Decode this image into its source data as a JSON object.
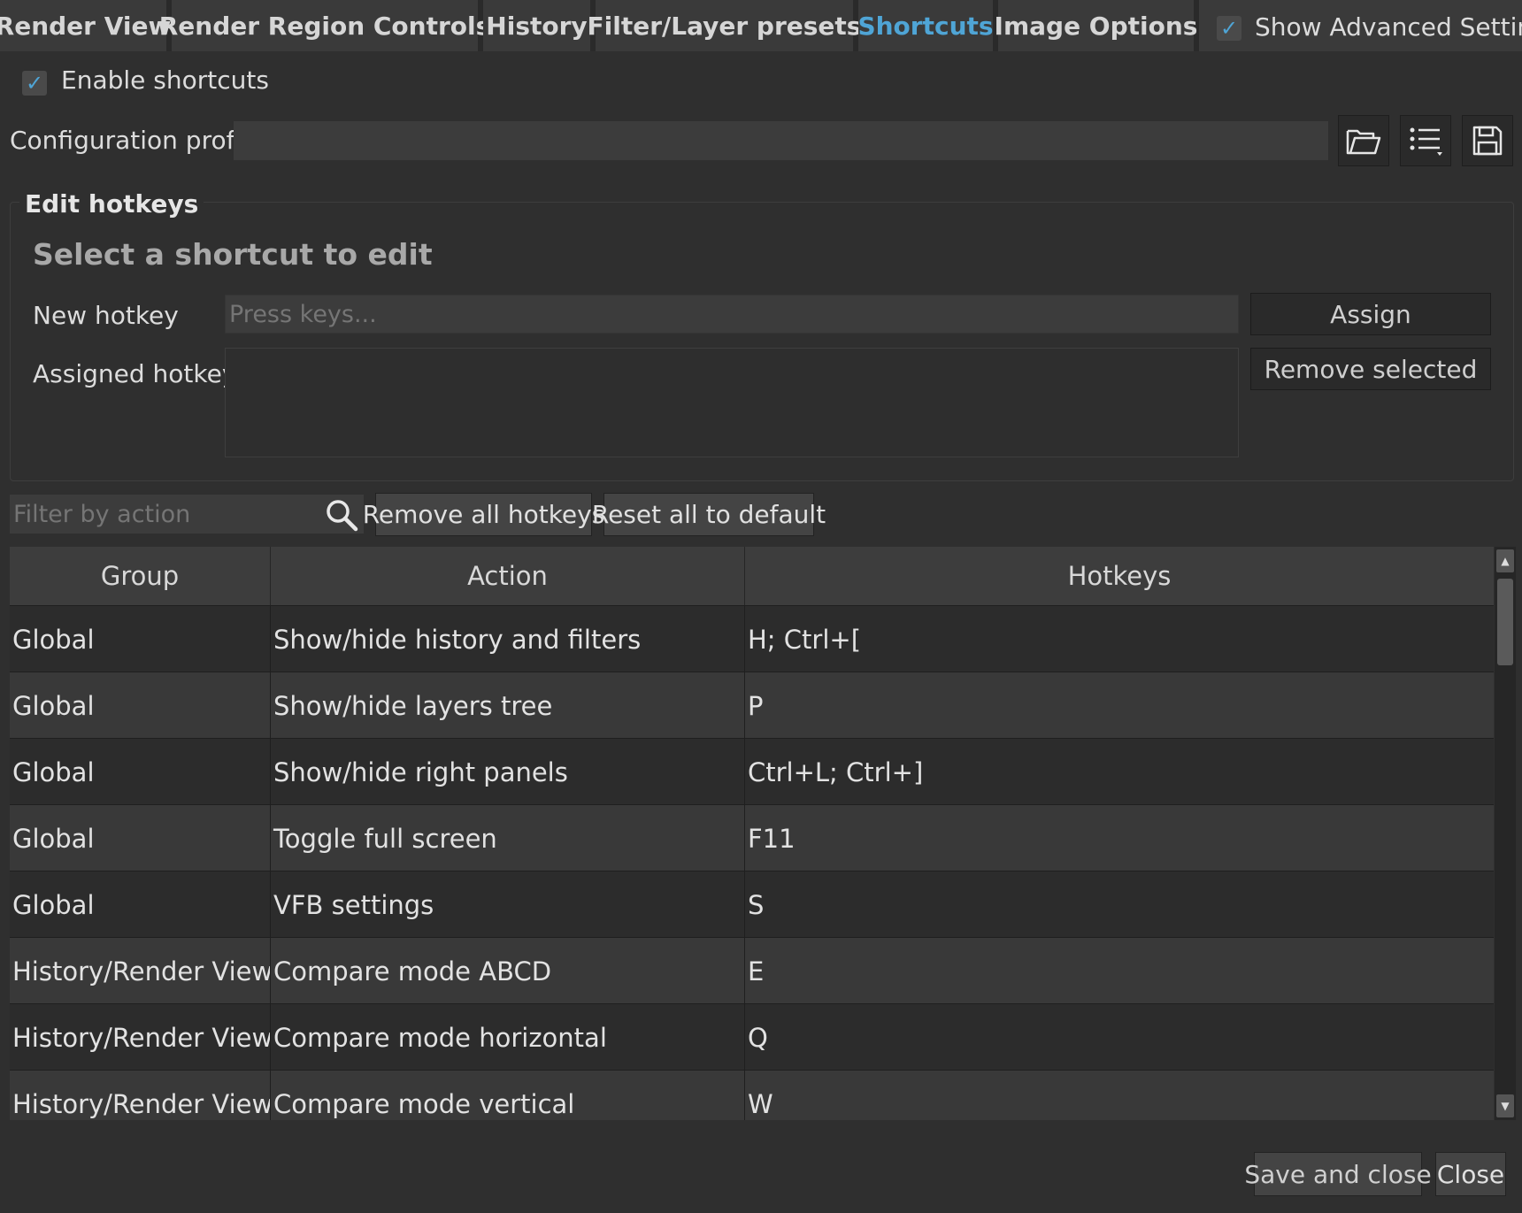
{
  "tabs": [
    {
      "label": "Render View"
    },
    {
      "label": "Render Region Controls"
    },
    {
      "label": "History"
    },
    {
      "label": "Filter/Layer presets"
    },
    {
      "label": "Shortcuts"
    },
    {
      "label": "Image Options"
    }
  ],
  "active_tab": "Shortcuts",
  "advanced": {
    "label": "Show Advanced Settings",
    "checked": true
  },
  "enable_shortcuts": {
    "label": "Enable shortcuts",
    "checked": true
  },
  "config": {
    "label": "Configuration profile",
    "value": ""
  },
  "edit": {
    "title": "Edit hotkeys",
    "heading": "Select a shortcut to edit",
    "new_hotkey_label": "New hotkey",
    "new_hotkey_placeholder": "Press keys...",
    "assigned_label": "Assigned hotkeys",
    "assign_button": "Assign",
    "remove_selected_button": "Remove selected"
  },
  "filter": {
    "placeholder": "Filter by action"
  },
  "remove_all_button": "Remove all hotkeys",
  "reset_all_button": "Reset all to default",
  "table": {
    "columns": [
      "Group",
      "Action",
      "Hotkeys"
    ],
    "rows": [
      {
        "group": "Global",
        "action": "Show/hide history and filters",
        "hotkeys": "H; Ctrl+["
      },
      {
        "group": "Global",
        "action": "Show/hide layers tree",
        "hotkeys": "P"
      },
      {
        "group": "Global",
        "action": "Show/hide right panels",
        "hotkeys": "Ctrl+L; Ctrl+]"
      },
      {
        "group": "Global",
        "action": "Toggle full screen",
        "hotkeys": "F11"
      },
      {
        "group": "Global",
        "action": "VFB settings",
        "hotkeys": "S"
      },
      {
        "group": "History/Render View",
        "action": "Compare mode ABCD",
        "hotkeys": "E"
      },
      {
        "group": "History/Render View",
        "action": "Compare mode horizontal",
        "hotkeys": "Q"
      },
      {
        "group": "History/Render View",
        "action": "Compare mode vertical",
        "hotkeys": "W"
      }
    ]
  },
  "footer": {
    "save_close": "Save and close",
    "close": "Close"
  },
  "icons": {
    "open": "folder-open-icon",
    "list": "list-menu-icon",
    "save": "floppy-disk-icon",
    "search": "search-icon",
    "check": "checkmark-icon",
    "scroll_up": "arrow-up-icon",
    "scroll_down": "arrow-down-icon"
  },
  "colors": {
    "accent": "#4fa5d6",
    "background": "#2f2f2f"
  }
}
